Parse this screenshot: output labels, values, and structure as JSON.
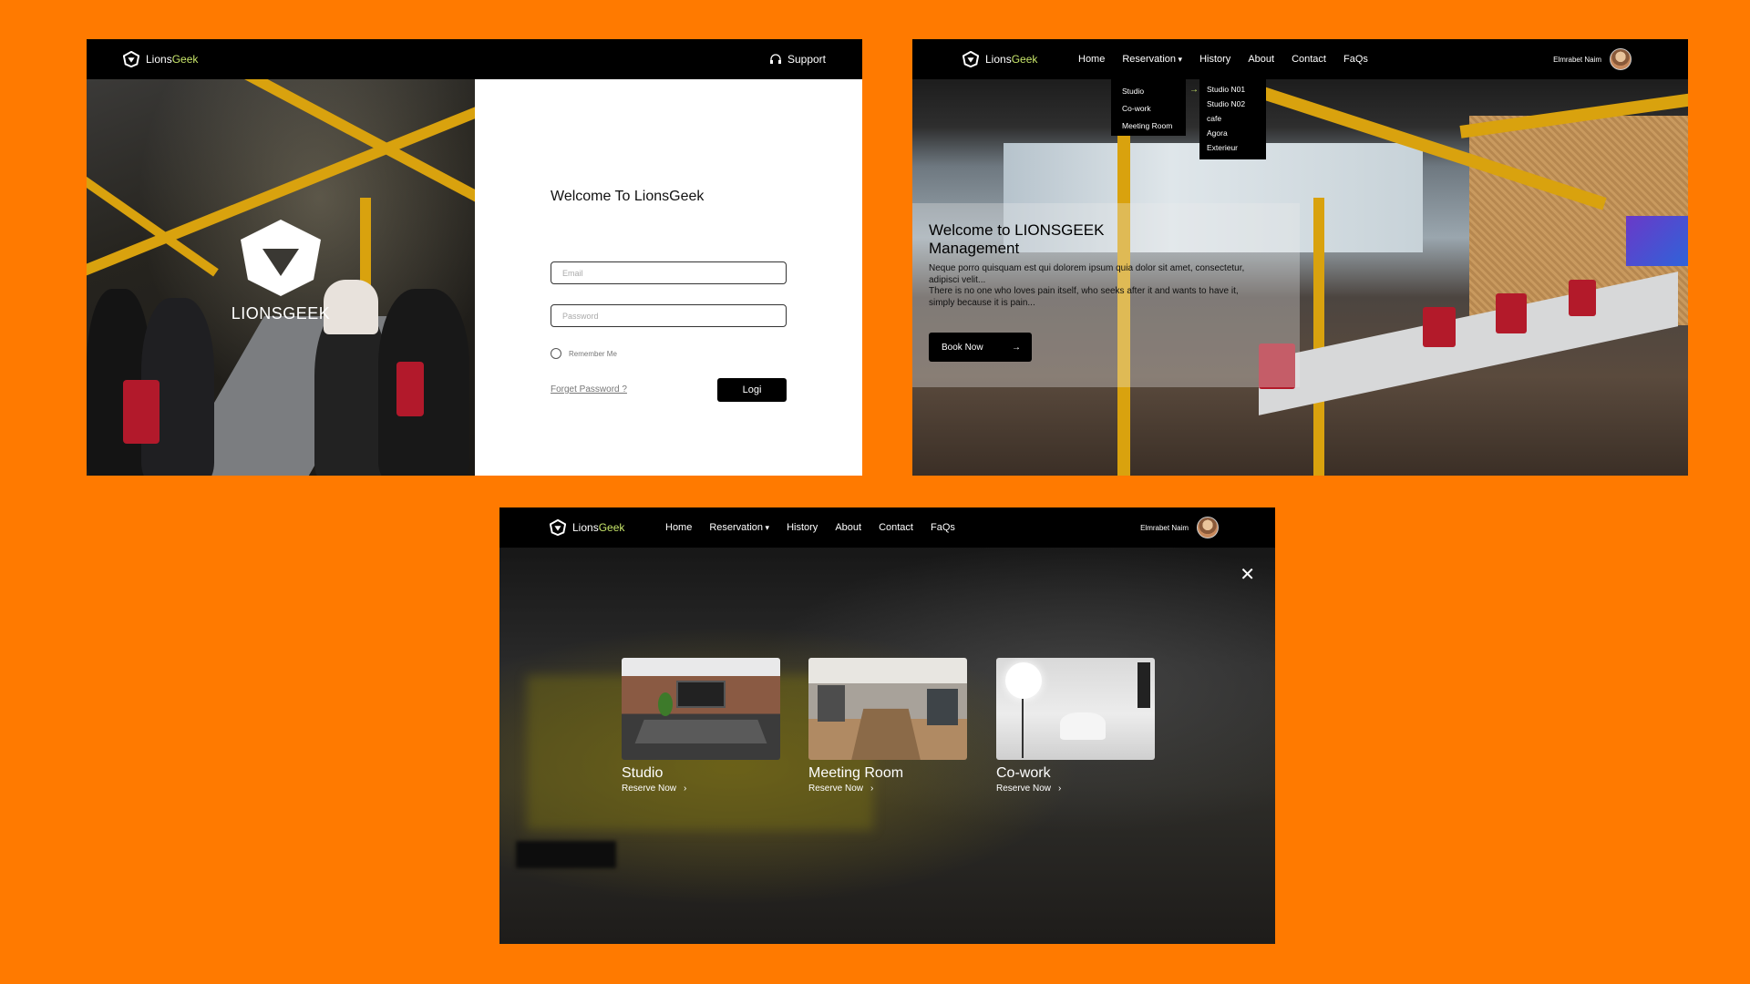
{
  "brand": {
    "name_part1": "Lions",
    "name_part2": "Geek",
    "accent_color": "#C8E66A",
    "background_color": "#FF7A00"
  },
  "login_screen": {
    "support_label": "Support",
    "hero_wordmark": "LIONSGEEK",
    "title": "Welcome To LionsGeek",
    "email_placeholder": "Email",
    "password_placeholder": "Password",
    "remember_label": "Remember Me",
    "forgot_label": "Forget Password ?",
    "login_button": "Logi"
  },
  "nav": {
    "home": "Home",
    "reservation": "Reservation",
    "history": "History",
    "about": "About",
    "contact": "Contact",
    "faqs": "FaQs",
    "user_name": "Elmrabet Naim"
  },
  "home_screen": {
    "hero_title": "Welcome to LIONSGEEK Management",
    "hero_text_line1": "Neque porro quisquam est qui dolorem ipsum quia dolor sit amet, consectetur, adipisci velit...",
    "hero_text_line2": "There is no one who loves pain itself, who seeks after it and wants to have it, simply because it is pain...",
    "book_button": "Book Now",
    "reservation_menu": [
      "Studio",
      "Co-work",
      "Meeting Room"
    ],
    "studio_submenu": [
      "Studio N01",
      "Studio N02",
      "cafe",
      "Agora",
      "Exterieur"
    ]
  },
  "modal_screen": {
    "close_symbol": "✕",
    "cards": [
      {
        "title": "Studio",
        "link": "Reserve Now"
      },
      {
        "title": "Meeting Room",
        "link": "Reserve Now"
      },
      {
        "title": "Co-work",
        "link": "Reserve Now"
      }
    ]
  }
}
